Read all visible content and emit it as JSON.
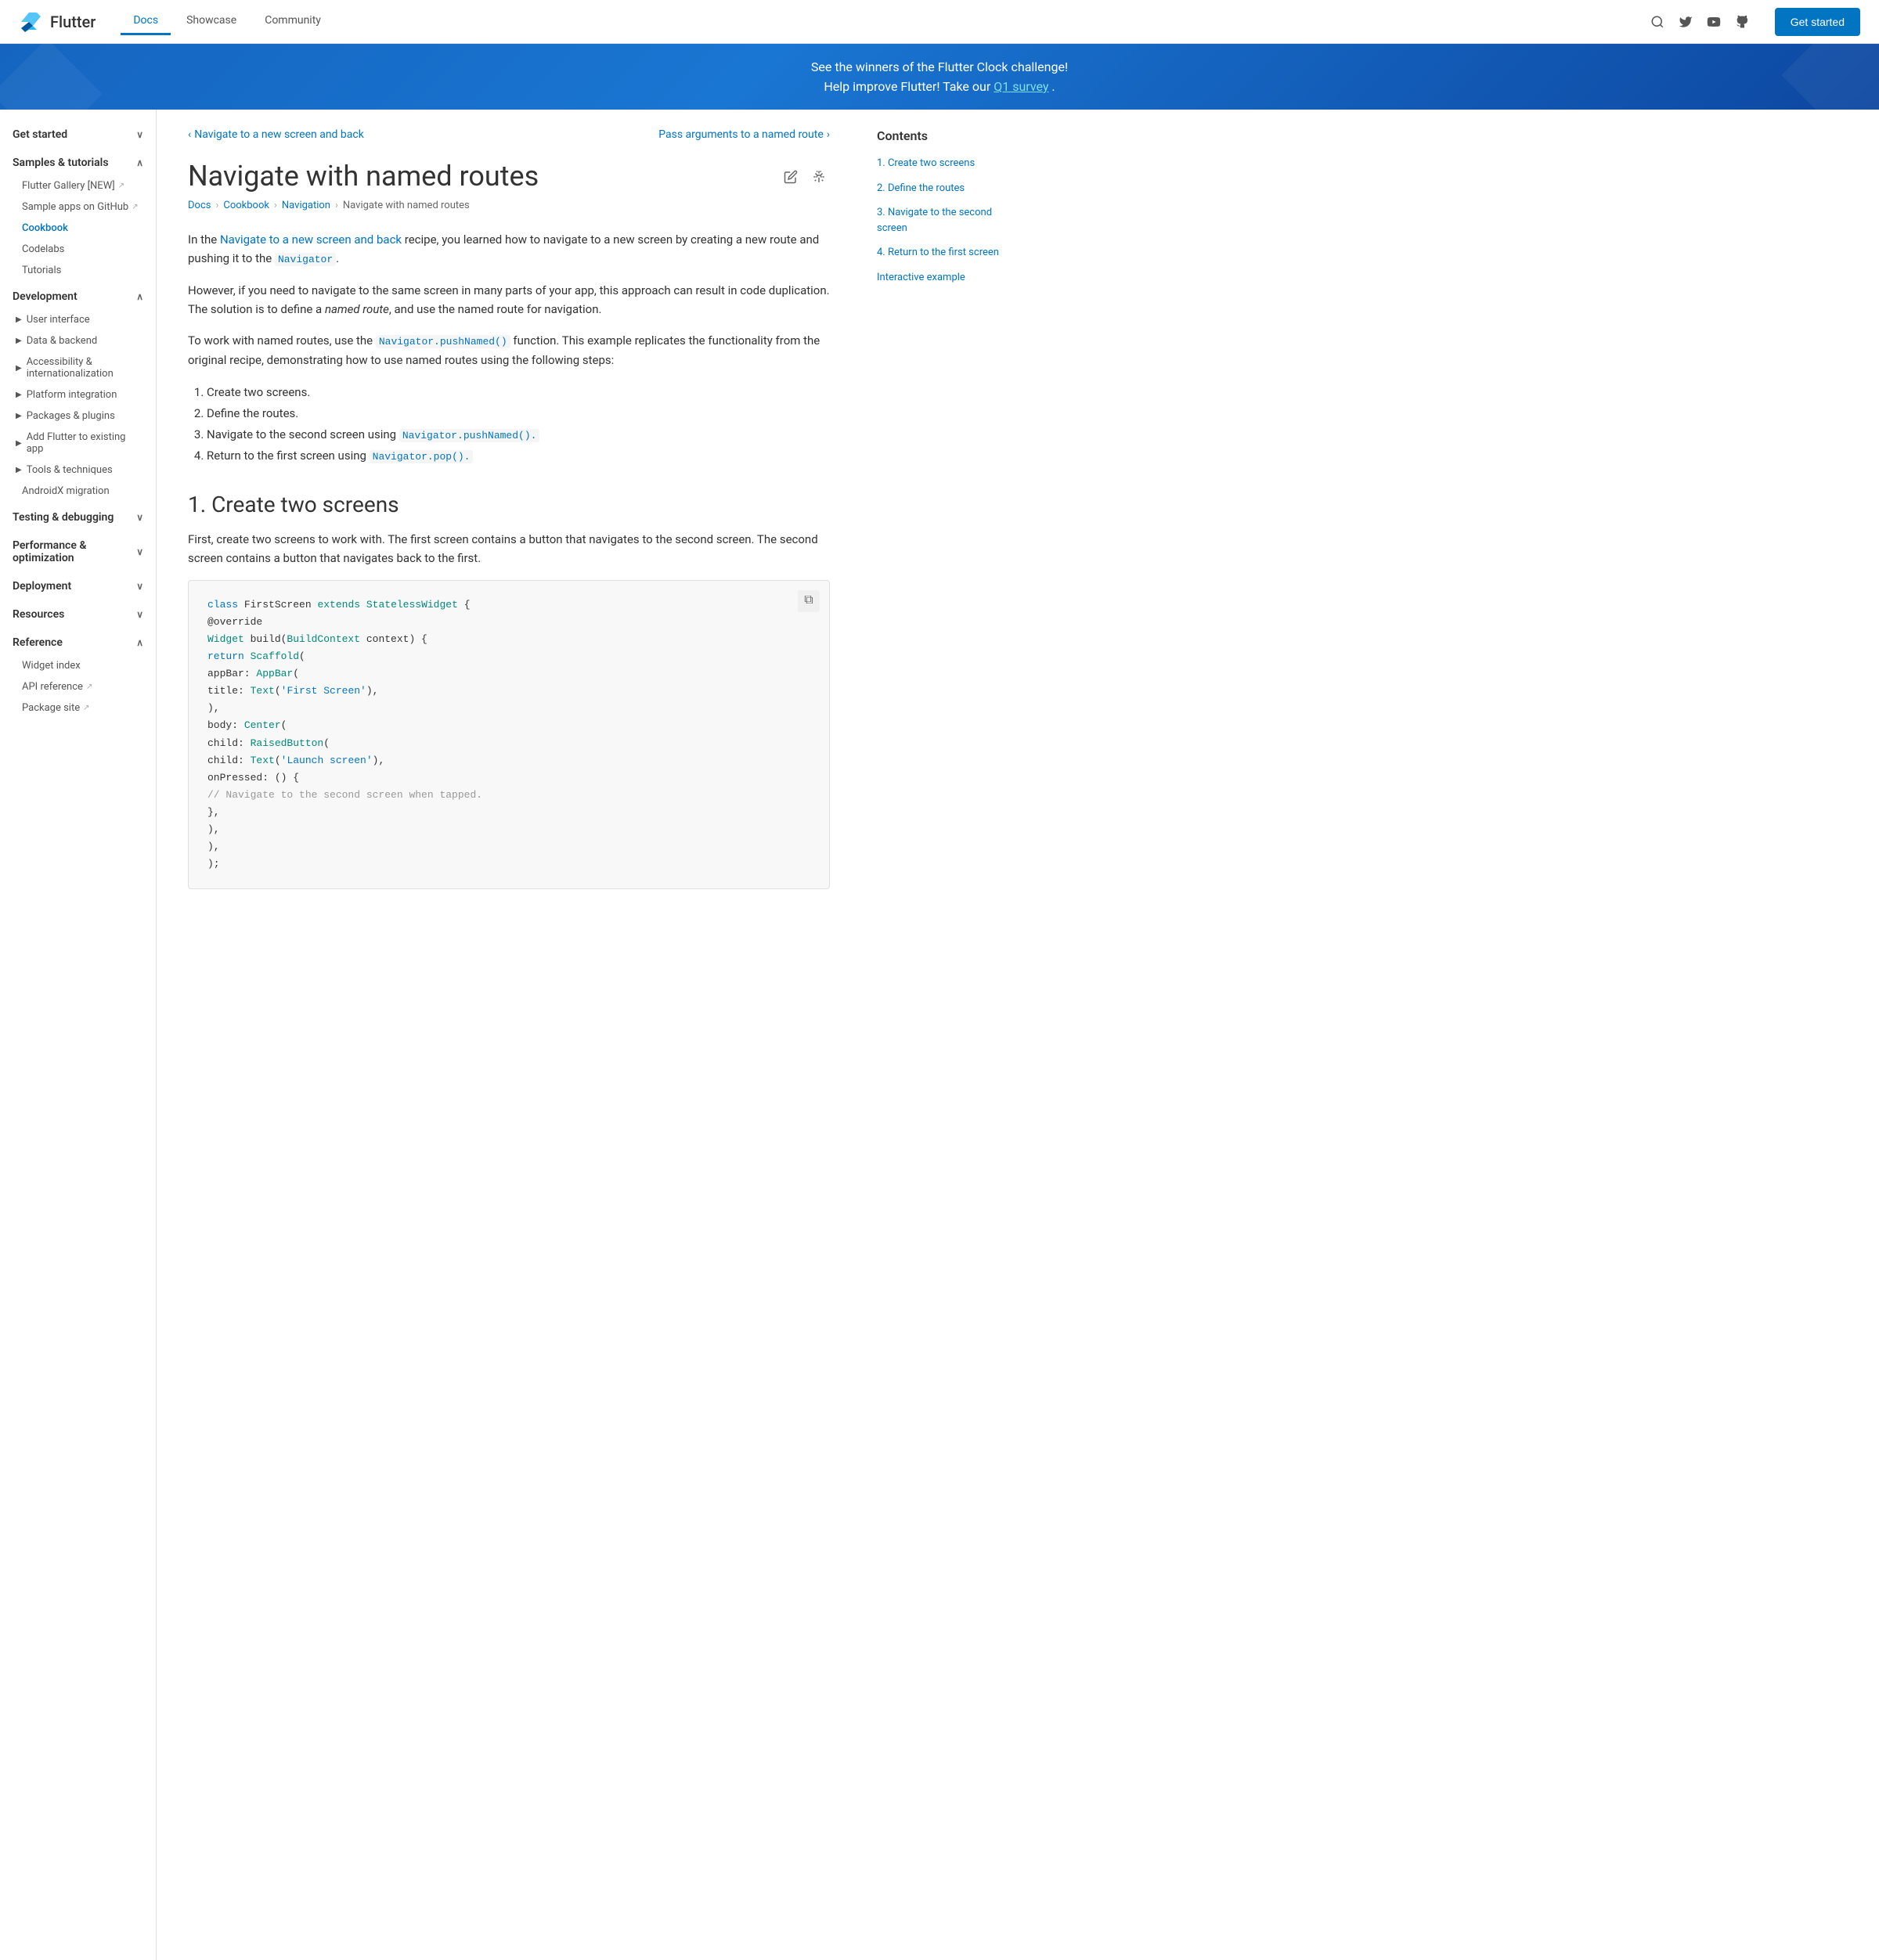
{
  "header": {
    "logo_text": "Flutter",
    "nav_items": [
      {
        "label": "Docs",
        "active": true
      },
      {
        "label": "Showcase",
        "active": false
      },
      {
        "label": "Community",
        "active": false
      }
    ],
    "get_started_label": "Get started"
  },
  "banner": {
    "line1": "See the winners of the Flutter Clock challenge!",
    "line2_prefix": "Help improve Flutter! Take our ",
    "line2_link": "Q1 survey",
    "line2_suffix": "."
  },
  "sidebar": {
    "sections": [
      {
        "label": "Get started",
        "expanded": true
      },
      {
        "label": "Samples & tutorials",
        "expanded": true,
        "items": [
          {
            "label": "Flutter Gallery [NEW]",
            "external": true
          },
          {
            "label": "Sample apps on GitHub",
            "external": true
          },
          {
            "label": "Cookbook",
            "active": true
          },
          {
            "label": "Codelabs"
          },
          {
            "label": "Tutorials"
          }
        ]
      },
      {
        "label": "Development",
        "expanded": true,
        "subitems": [
          {
            "label": "User interface",
            "expandable": true
          },
          {
            "label": "Data & backend",
            "expandable": true
          },
          {
            "label": "Accessibility & internationalization",
            "expandable": true
          },
          {
            "label": "Platform integration",
            "expandable": true
          },
          {
            "label": "Packages & plugins",
            "expandable": true
          },
          {
            "label": "Add Flutter to existing app",
            "expandable": true
          },
          {
            "label": "Tools & techniques",
            "expandable": true
          },
          {
            "label": "AndroidX migration"
          }
        ]
      },
      {
        "label": "Testing & debugging",
        "expanded": false
      },
      {
        "label": "Performance & optimization",
        "expanded": false
      },
      {
        "label": "Deployment",
        "expanded": false
      },
      {
        "label": "Resources",
        "expanded": false
      },
      {
        "label": "Reference",
        "expanded": true,
        "items": [
          {
            "label": "Widget index"
          },
          {
            "label": "API reference",
            "external": true
          },
          {
            "label": "Package site",
            "external": true
          }
        ]
      }
    ]
  },
  "prev_nav": {
    "label": "Navigate to a new screen and back",
    "icon": "‹"
  },
  "next_nav": {
    "label": "Pass arguments to a named route",
    "icon": "›"
  },
  "page": {
    "title": "Navigate with named routes",
    "breadcrumb": [
      "Docs",
      "Cookbook",
      "Navigation",
      "Navigate with named routes"
    ],
    "intro_paragraphs": [
      {
        "text_before": "In the ",
        "link": "Navigate to a new screen and back",
        "text_after": " recipe, you learned how to navigate to a new screen by creating a new route and pushing it to the ",
        "code": "Navigator",
        "text_end": "."
      }
    ],
    "para2": "However, if you need to navigate to the same screen in many parts of your app, this approach can result in code duplication. The solution is to define a named route, and use the named route for navigation.",
    "para2_italic": "named route",
    "para3_before": "To work with named routes, use the ",
    "para3_code": "Navigator.pushNamed()",
    "para3_after": " function. This example replicates the functionality from the original recipe, demonstrating how to use named routes using the following steps:",
    "steps": [
      "Create two screens.",
      "Define the routes.",
      {
        "text_before": "Navigate to the second screen using ",
        "code": "Navigator.pushNamed().",
        "text_after": ""
      },
      {
        "text_before": "Return to the first screen using ",
        "code": "Navigator.pop().",
        "text_after": ""
      }
    ],
    "section1_title": "1. Create two screens",
    "section1_text": "First, create two screens to work with. The first screen contains a button that navigates to the second screen. The second screen contains a button that navigates back to the first."
  },
  "code_block": {
    "copy_icon": "⧉",
    "lines": [
      {
        "parts": [
          {
            "type": "kw-blue",
            "t": "class"
          },
          {
            "type": "normal",
            "t": " FirstScreen "
          },
          {
            "type": "kw-teal",
            "t": "extends"
          },
          {
            "type": "normal",
            "t": " "
          },
          {
            "type": "kw-teal",
            "t": "StatelessWidget"
          },
          {
            "type": "normal",
            "t": " {"
          }
        ]
      },
      {
        "parts": [
          {
            "type": "normal",
            "t": "  @override"
          }
        ]
      },
      {
        "parts": [
          {
            "type": "kw-teal",
            "t": "  Widget"
          },
          {
            "type": "normal",
            "t": " build("
          },
          {
            "type": "kw-teal",
            "t": "BuildContext"
          },
          {
            "type": "normal",
            "t": " context) {"
          }
        ]
      },
      {
        "parts": [
          {
            "type": "normal",
            "t": "    "
          },
          {
            "type": "kw-blue",
            "t": "return"
          },
          {
            "type": "normal",
            "t": " "
          },
          {
            "type": "kw-teal",
            "t": "Scaffold"
          },
          {
            "type": "normal",
            "t": "("
          }
        ]
      },
      {
        "parts": [
          {
            "type": "normal",
            "t": "      appBar: "
          },
          {
            "type": "kw-teal",
            "t": "AppBar"
          },
          {
            "type": "normal",
            "t": "("
          }
        ]
      },
      {
        "parts": [
          {
            "type": "normal",
            "t": "        title: "
          },
          {
            "type": "kw-teal",
            "t": "Text"
          },
          {
            "type": "normal",
            "t": "("
          },
          {
            "type": "str-blue",
            "t": "'First Screen'"
          },
          {
            "type": "normal",
            "t": "),"
          }
        ]
      },
      {
        "parts": [
          {
            "type": "normal",
            "t": "      ),"
          }
        ]
      },
      {
        "parts": [
          {
            "type": "normal",
            "t": "      body: "
          },
          {
            "type": "kw-teal",
            "t": "Center"
          },
          {
            "type": "normal",
            "t": "("
          }
        ]
      },
      {
        "parts": [
          {
            "type": "normal",
            "t": "        child: "
          },
          {
            "type": "kw-teal",
            "t": "RaisedButton"
          },
          {
            "type": "normal",
            "t": "("
          }
        ]
      },
      {
        "parts": [
          {
            "type": "normal",
            "t": "          child: "
          },
          {
            "type": "kw-teal",
            "t": "Text"
          },
          {
            "type": "normal",
            "t": "("
          },
          {
            "type": "str-blue",
            "t": "'Launch screen'"
          },
          {
            "type": "normal",
            "t": "),"
          }
        ]
      },
      {
        "parts": [
          {
            "type": "normal",
            "t": "          onPressed: () {"
          }
        ]
      },
      {
        "parts": [
          {
            "type": "comment",
            "t": "            // Navigate to the second screen when tapped."
          }
        ]
      },
      {
        "parts": [
          {
            "type": "normal",
            "t": "          },"
          }
        ]
      },
      {
        "parts": [
          {
            "type": "normal",
            "t": "        ),"
          }
        ]
      },
      {
        "parts": [
          {
            "type": "normal",
            "t": "      ),"
          }
        ]
      },
      {
        "parts": [
          {
            "type": "normal",
            "t": "    );"
          }
        ]
      }
    ]
  },
  "toc": {
    "title": "Contents",
    "items": [
      "1. Create two screens",
      "2. Define the routes",
      "3. Navigate to the second screen",
      "4. Return to the first screen",
      "Interactive example"
    ]
  }
}
